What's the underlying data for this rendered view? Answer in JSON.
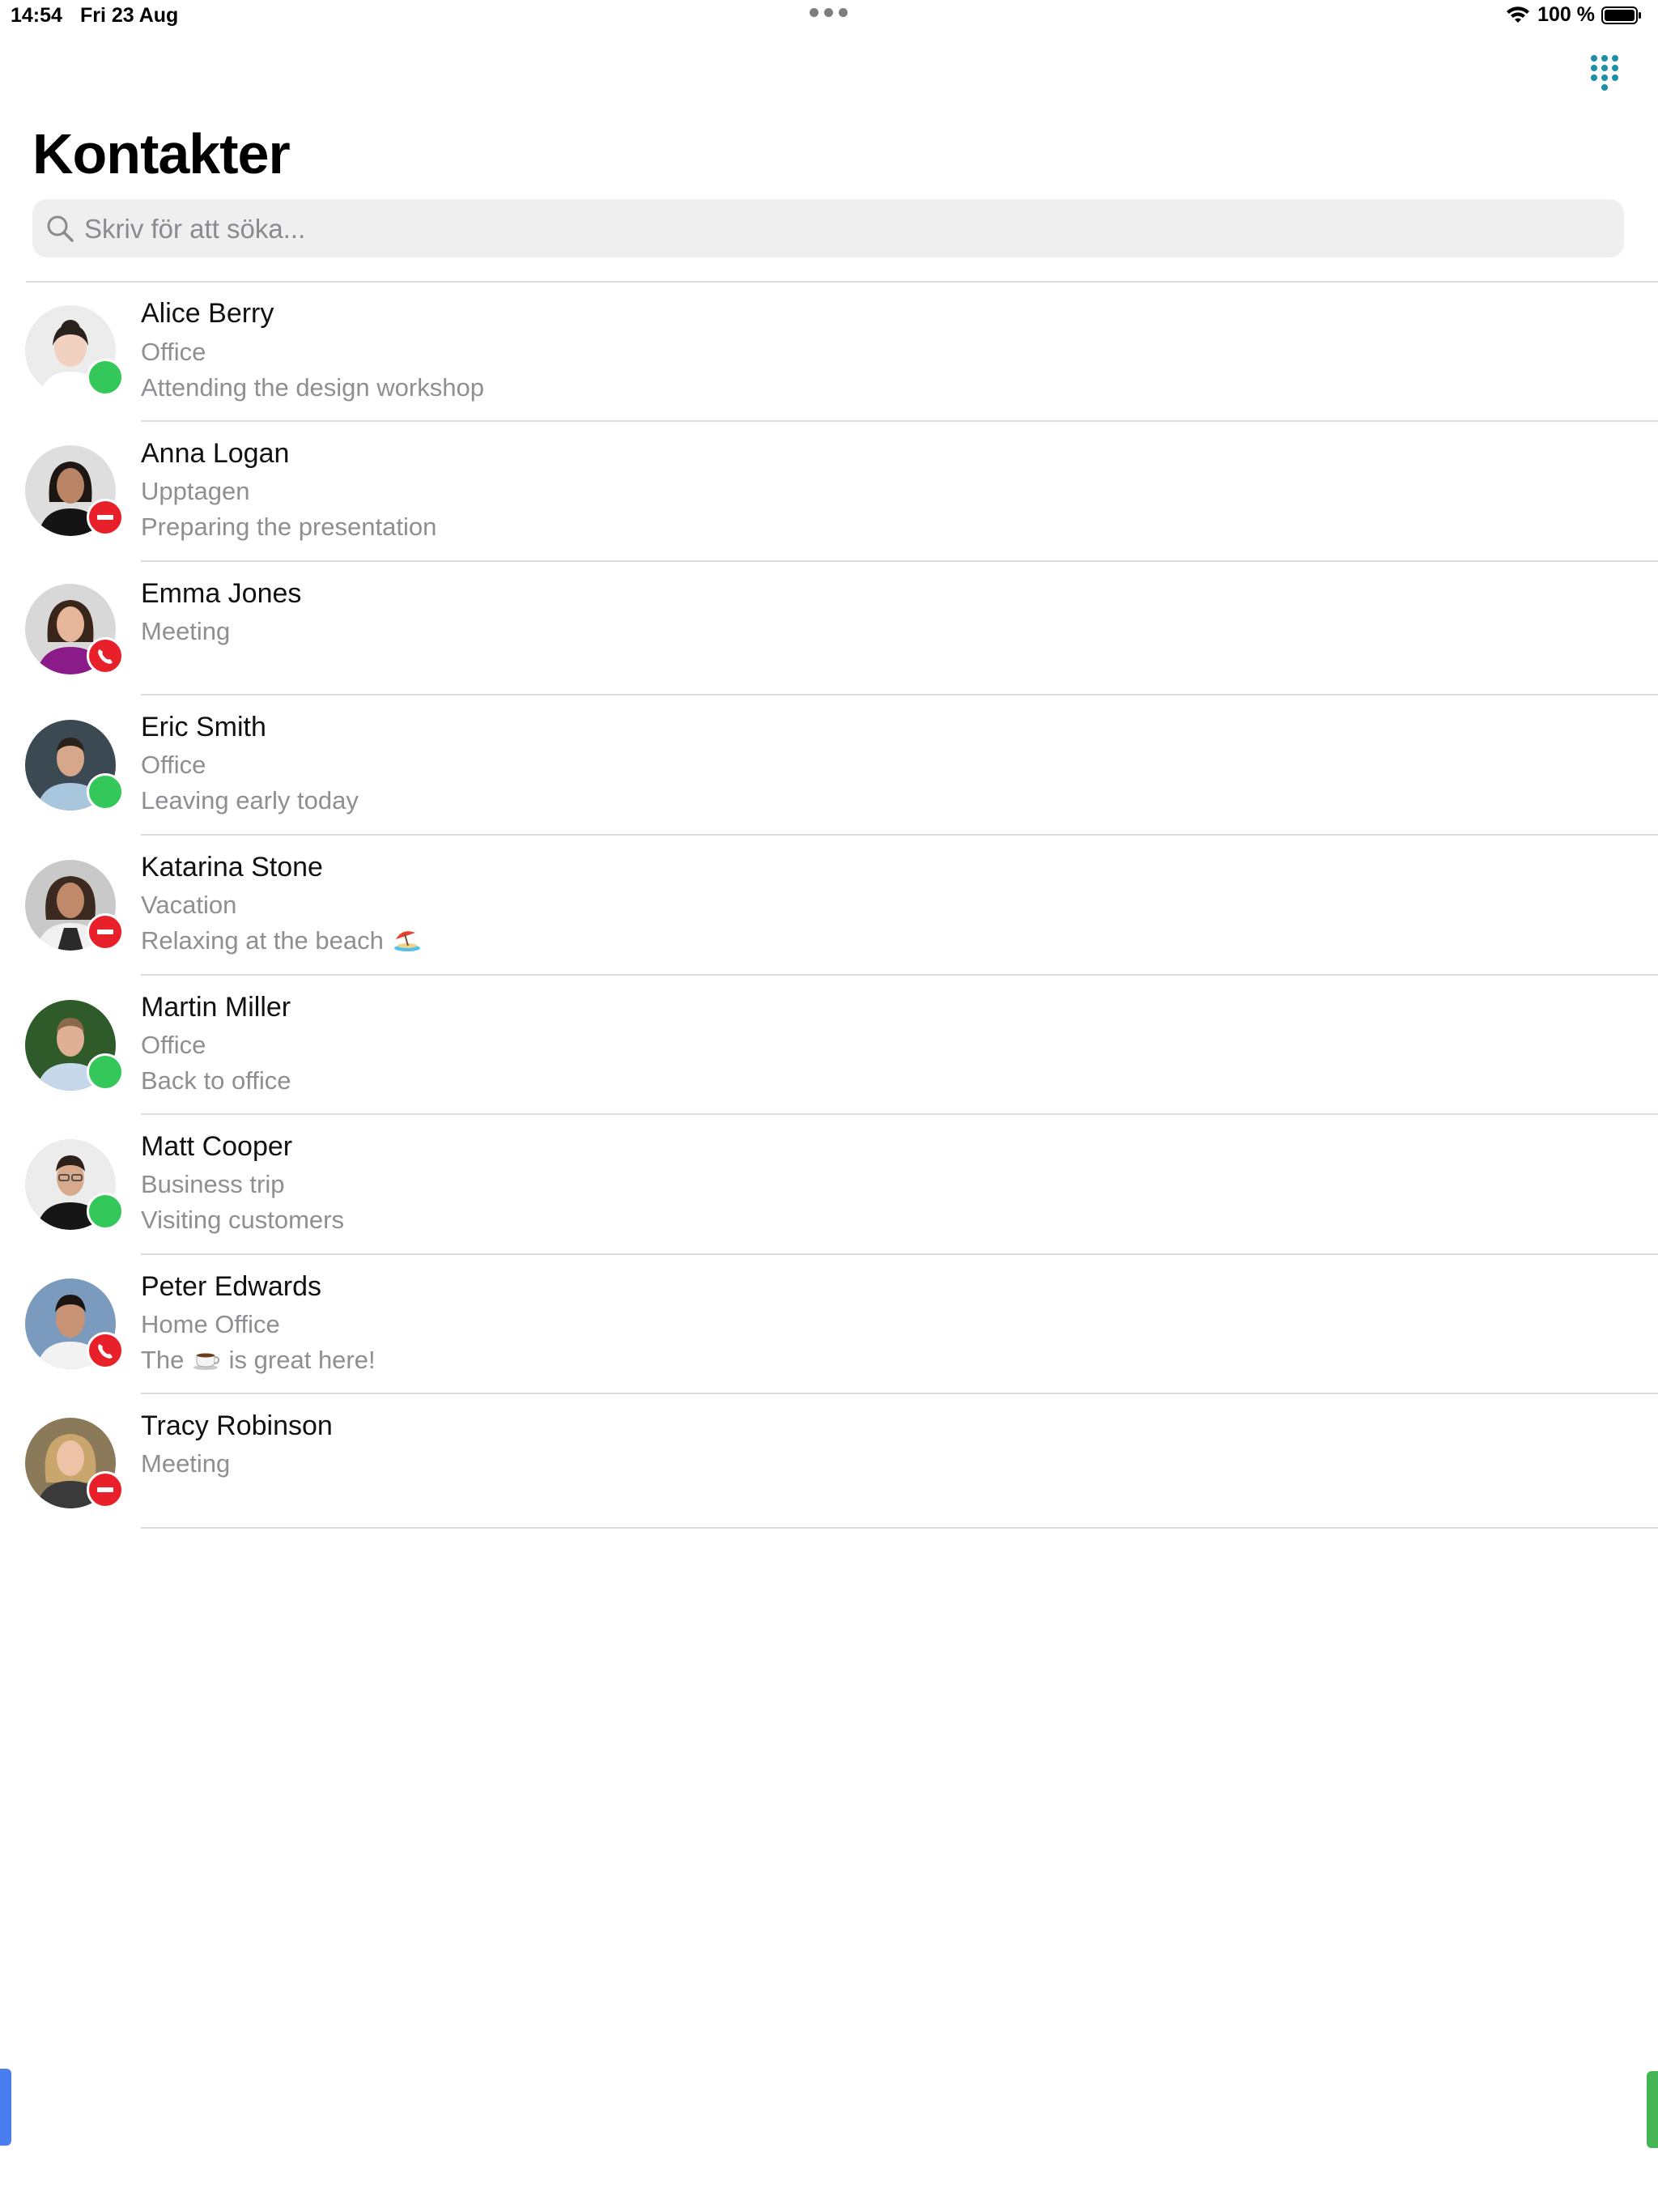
{
  "status_bar": {
    "time": "14:54",
    "date": "Fri 23 Aug",
    "battery": "100 %",
    "icons": [
      "wifi-icon",
      "battery-icon"
    ]
  },
  "nav": {
    "right_button_icon": "dialpad-icon",
    "accent_color": "#1a8fa6"
  },
  "title": "Kontakter",
  "search": {
    "placeholder": "Skriv för att söka...",
    "value": "",
    "icon": "search-icon"
  },
  "status_colors": {
    "available": "#34c759",
    "busy": "#e8202a",
    "on_call": "#e8202a"
  },
  "contacts": [
    {
      "name": "Alice Berry",
      "status_label": "Office",
      "message": "Attending the design workshop",
      "status": "available"
    },
    {
      "name": "Anna Logan",
      "status_label": "Upptagen",
      "message": "Preparing the presentation",
      "status": "busy"
    },
    {
      "name": "Emma Jones",
      "status_label": "Meeting",
      "message": "",
      "status": "on_call"
    },
    {
      "name": "Eric Smith",
      "status_label": "Office",
      "message": "Leaving early today",
      "status": "available"
    },
    {
      "name": "Katarina Stone",
      "status_label": "Vacation",
      "message": "Relaxing at the beach",
      "message_emoji": "beach-umbrella-icon",
      "status": "busy"
    },
    {
      "name": "Martin Miller",
      "status_label": "Office",
      "message": "Back to office",
      "status": "available"
    },
    {
      "name": "Matt Cooper",
      "status_label": "Business trip",
      "message": "Visiting customers",
      "status": "available"
    },
    {
      "name": "Peter Edwards",
      "status_label": "Home Office",
      "message_before": "The",
      "message_emoji": "coffee-icon",
      "message_after": "is great here!",
      "status": "on_call"
    },
    {
      "name": "Tracy Robinson",
      "status_label": "Meeting",
      "message": "",
      "status": "busy"
    }
  ]
}
